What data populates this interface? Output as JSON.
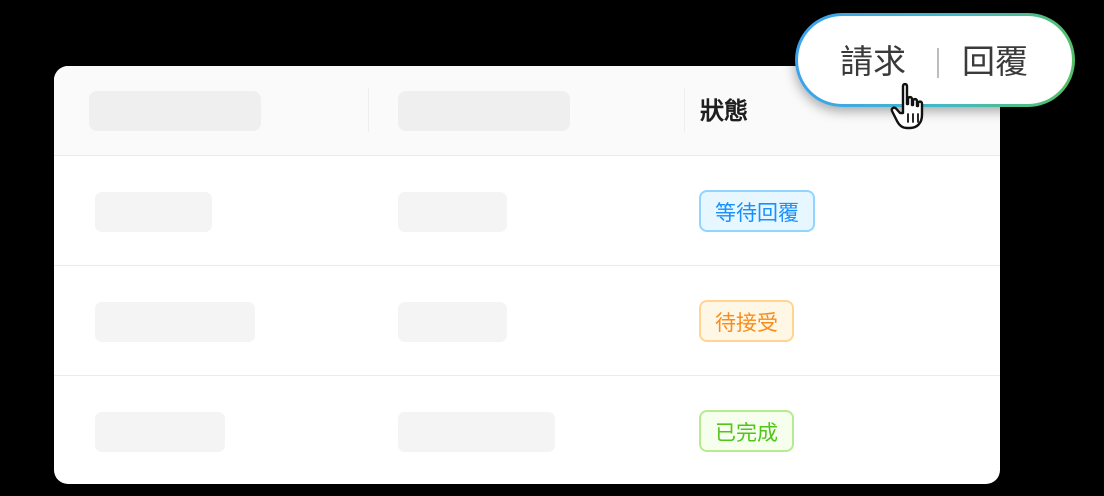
{
  "table": {
    "header": {
      "status_label": "狀態"
    },
    "rows": [
      {
        "status": "等待回覆",
        "status_color": "blue"
      },
      {
        "status": "待接受",
        "status_color": "orange"
      },
      {
        "status": "已完成",
        "status_color": "green"
      }
    ]
  },
  "toggle": {
    "left_label": "請求",
    "right_label": "回覆"
  },
  "colors": {
    "background": "#000000",
    "card": "#ffffff",
    "blue_text": "#1890ff",
    "orange_text": "#fa8c16",
    "green_text": "#52c41a",
    "toggle_gradient_start": "#3aa0f0",
    "toggle_gradient_end": "#55c060"
  },
  "icons": {
    "cursor": "hand-pointer-icon"
  }
}
